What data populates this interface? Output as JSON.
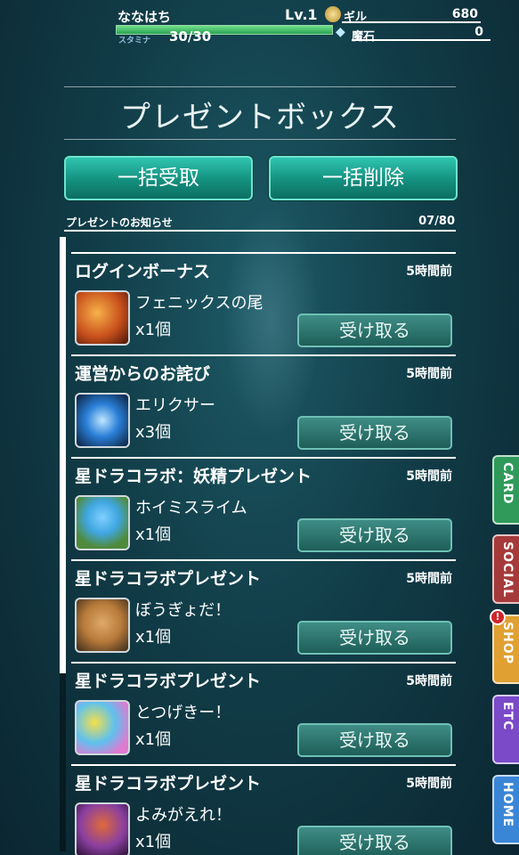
{
  "header": {
    "player_name": "ななはち",
    "level": "Lv.1",
    "stamina_label": "スタミナ",
    "stamina_value": "30/30",
    "stamina_fraction": 1.0,
    "gil_label": "ギル",
    "gil_value": "680",
    "stone_label": "魔石",
    "stone_value": "0"
  },
  "page": {
    "title": "プレゼントボックス",
    "receive_all_label": "一括受取",
    "delete_all_label": "一括削除",
    "notice_label": "プレゼントのお知らせ",
    "notice_count": "07/80"
  },
  "items": [
    {
      "title": "ログインボーナス",
      "time": "5時間前",
      "name": "フェニックスの尾",
      "qty": "x1個",
      "button": "受け取る",
      "icon": "phoenix-down-icon",
      "color": "#c8501c"
    },
    {
      "title": "運営からのお詫び",
      "time": "5時間前",
      "name": "エリクサー",
      "qty": "x3個",
      "button": "受け取る",
      "icon": "elixir-icon",
      "color": "#2a7fd8"
    },
    {
      "title": "星ドラコラボ：妖精プレゼント",
      "time": "5時間前",
      "name": "ホイミスライム",
      "qty": "x1個",
      "button": "受け取る",
      "icon": "healslime-icon",
      "color": "#3fa6e0"
    },
    {
      "title": "星ドラコラボプレゼント",
      "time": "5時間前",
      "name": "ぼうぎょだ！",
      "qty": "x1個",
      "button": "受け取る",
      "icon": "golem-icon",
      "color": "#b77a3a"
    },
    {
      "title": "星ドラコラボプレゼント",
      "time": "5時間前",
      "name": "とつげきー！",
      "qty": "x1個",
      "button": "受け取る",
      "icon": "slimes-icon",
      "color": "#5ec1ef"
    },
    {
      "title": "星ドラコラボプレゼント",
      "time": "5時間前",
      "name": "よみがえれ！",
      "qty": "x1個",
      "button": "受け取る",
      "icon": "dragon-icon",
      "color": "#8a3fa0"
    }
  ],
  "side_tabs": [
    {
      "label": "CARD",
      "color": "#2f9a5a"
    },
    {
      "label": "SOCIAL",
      "color": "#a63a3a"
    },
    {
      "label": "SHOP",
      "color": "#e0a032"
    },
    {
      "label": "ETC",
      "color": "#7a4ac8"
    },
    {
      "label": "HOME",
      "color": "#3a86d6"
    }
  ],
  "shop_badge": "!"
}
